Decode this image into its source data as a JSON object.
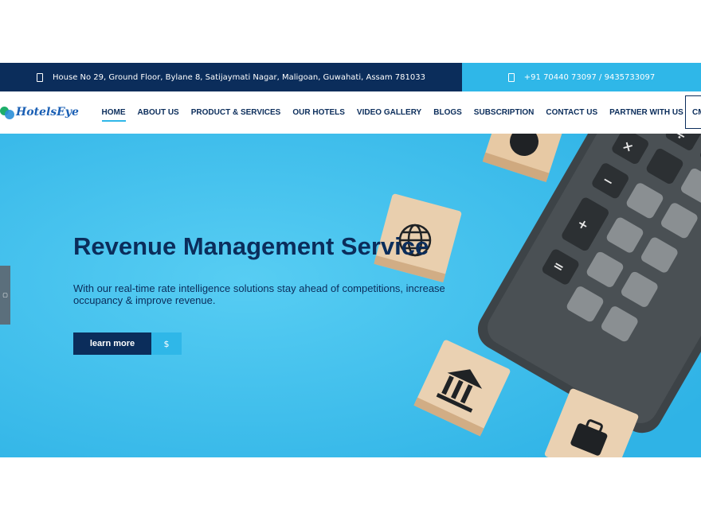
{
  "topbar": {
    "address": "House No 29, Ground Floor, Bylane 8, Satijaymati Nagar, Maligoan, Guwahati, Assam 781033",
    "phone": "+91 70440 73097 / 9435733097"
  },
  "brand": {
    "logo_text": "HotelsEye"
  },
  "nav": {
    "items": [
      {
        "label": "HOME"
      },
      {
        "label": "ABOUT US"
      },
      {
        "label": "PRODUCT & SERVICES"
      },
      {
        "label": "OUR HOTELS"
      },
      {
        "label": "VIDEO GALLERY"
      },
      {
        "label": "BLOGS"
      },
      {
        "label": "SUBSCRIPTION"
      },
      {
        "label": "CONTACT US"
      },
      {
        "label": "PARTNER WITH US"
      }
    ],
    "cta_label": "CM"
  },
  "hero": {
    "title": "Revenue Management Service",
    "subtitle": "With our real-time rate intelligence solutions stay ahead of competitions, increase occupancy & improve revenue.",
    "button_label": "learn more",
    "button_icon": "$"
  },
  "colors": {
    "navy": "#0b2d5b",
    "sky": "#2fb7e8",
    "hero_bg": "#3ec1ee"
  },
  "icons": [
    "map-marker-icon",
    "phone-icon",
    "dollar-icon",
    "side-tab-icon"
  ]
}
